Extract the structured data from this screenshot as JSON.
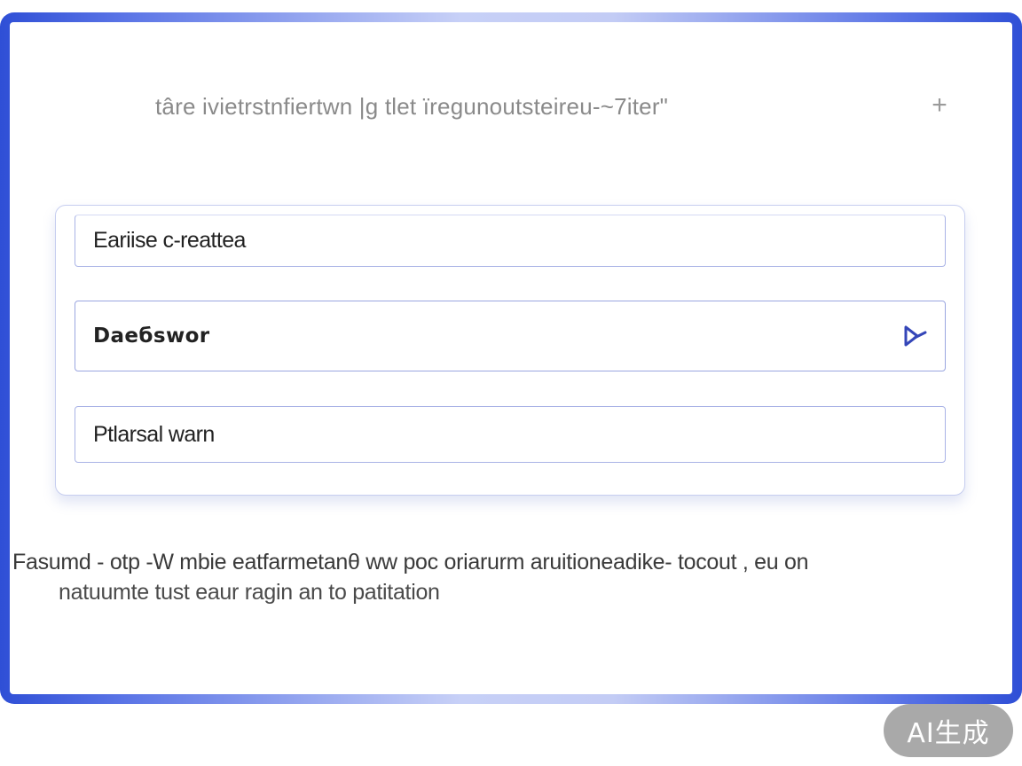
{
  "dialog": {
    "title": "târe  ivietrstnfiertwn |g tlet ïregunoutsteireu-~7iter\"",
    "close_symbol": "+",
    "close_icon": "plus-icon"
  },
  "form": {
    "fields": [
      {
        "value": "Eariise c-reattea"
      },
      {
        "value": "Daeбswor",
        "icon": "play-arrow-icon"
      },
      {
        "value": "Ptlarsal warn"
      }
    ]
  },
  "description": {
    "line1": "Fasumd - otp -W mbie eatfarmetanθ ww poc oriarurm aruitioneadike- tocout , eu on",
    "line2": "natuumte tust eaur ragin an to patitation"
  },
  "badge": {
    "label": "AI生成"
  },
  "colors": {
    "accent": "#2f4fd6",
    "field_border": "#a9b3e6",
    "icon": "#3446b8",
    "badge_bg": "#a9a9a9"
  }
}
